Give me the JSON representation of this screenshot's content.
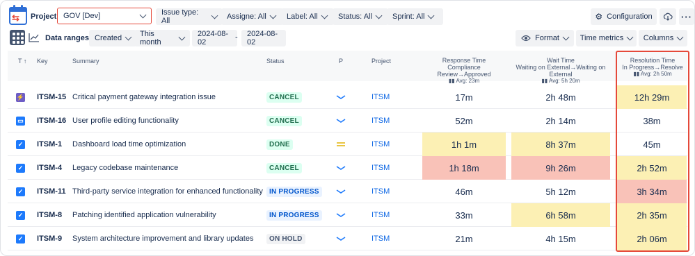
{
  "toolbar": {
    "project_label": "Project:",
    "project_value": "GOV [Dev]",
    "filters": [
      "Issue type: All",
      "Assigne: All",
      "Label: All",
      "Status: All",
      "Sprint: All"
    ],
    "configuration": "Configuration",
    "data_ranges_label": "Data ranges:",
    "created": "Created",
    "this_month": "This month",
    "date_from": "2024-08-02",
    "date_sep": "-",
    "date_to": "2024-08-02",
    "format": "Format",
    "time_metrics": "Time metrics",
    "columns": "Columns"
  },
  "table": {
    "headers": {
      "type": "T",
      "key": "Key",
      "summary": "Summary",
      "status": "Status",
      "priority": "P",
      "project": "Project",
      "response_title": "Response Time",
      "response_sub": "Compliance Review→Approved",
      "response_avg": "Avg: 23m",
      "wait_title": "Wait Time",
      "wait_sub": "Waiting on External→Waiting on External",
      "wait_avg": "Avg: 5h 20m",
      "resolution_title": "Resolution Time",
      "resolution_sub": "In Progress→Resolve",
      "resolution_avg": "Avg: 2h 50m"
    },
    "rows": [
      {
        "type": "story",
        "key": "ITSM-15",
        "summary": "Critical payment gateway integration issue",
        "status": "CANCEL",
        "priority": "low",
        "project": "ITSM",
        "response": "17m",
        "wait": "2h 48m",
        "resolution": "12h 29m",
        "response_hl": "",
        "wait_hl": "",
        "resolution_hl": "yellow"
      },
      {
        "type": "subtask",
        "key": "ITSM-16",
        "summary": "User profile editing functionality",
        "status": "CANCEL",
        "priority": "low",
        "project": "ITSM",
        "response": "52m",
        "wait": "2h 14m",
        "resolution": "38m",
        "response_hl": "",
        "wait_hl": "",
        "resolution_hl": ""
      },
      {
        "type": "task",
        "key": "ITSM-1",
        "summary": "Dashboard load time optimization",
        "status": "DONE",
        "priority": "medium",
        "project": "ITSM",
        "response": "1h 1m",
        "wait": "8h 37m",
        "resolution": "45m",
        "response_hl": "yellow",
        "wait_hl": "yellow",
        "resolution_hl": ""
      },
      {
        "type": "task",
        "key": "ITSM-4",
        "summary": "Legacy codebase maintenance",
        "status": "CANCEL",
        "priority": "low",
        "project": "ITSM",
        "response": "1h 18m",
        "wait": "9h 26m",
        "resolution": "2h 52m",
        "response_hl": "red",
        "wait_hl": "red",
        "resolution_hl": "yellow"
      },
      {
        "type": "task",
        "key": "ITSM-11",
        "summary": "Third-party service integration for enhanced functionality",
        "status": "IN PROGRESS",
        "priority": "low",
        "project": "ITSM",
        "response": "46m",
        "wait": "5h 12m",
        "resolution": "3h 34m",
        "response_hl": "",
        "wait_hl": "",
        "resolution_hl": "red"
      },
      {
        "type": "task",
        "key": "ITSM-8",
        "summary": "Patching identified application vulnerability",
        "status": "IN PROGRESS",
        "priority": "low",
        "project": "ITSM",
        "response": "33m",
        "wait": "6h 58m",
        "resolution": "2h 35m",
        "response_hl": "",
        "wait_hl": "yellow",
        "resolution_hl": "yellow"
      },
      {
        "type": "task",
        "key": "ITSM-9",
        "summary": "System architecture improvement and library updates",
        "status": "ON HOLD",
        "priority": "low",
        "project": "ITSM",
        "response": "21m",
        "wait": "4h 15m",
        "resolution": "2h 06m",
        "response_hl": "",
        "wait_hl": "",
        "resolution_hl": "yellow"
      }
    ]
  },
  "colors": {
    "accent_red": "#e5493a",
    "yellow_cell": "#fcf0b4",
    "red_cell": "#f9c2b8",
    "done_bg": "#dcfff1",
    "done_fg": "#216e4e",
    "progress_bg": "#e9f2ff",
    "progress_fg": "#0055cc",
    "hold_bg": "#f1f2f4",
    "hold_fg": "#44546f"
  }
}
